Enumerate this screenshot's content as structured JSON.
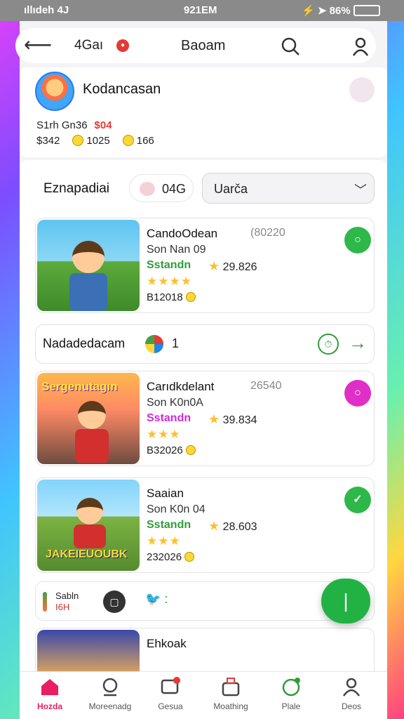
{
  "status_bar": {
    "left": "ıllıdeh 4J",
    "time": "921EM",
    "battery": "86%"
  },
  "header": {
    "back_icon": "back-arrow-icon",
    "tag": "4Gaı",
    "title": "Baoam"
  },
  "profile": {
    "name": "Kodancasan",
    "line1": "S1rh  Gn36",
    "line1_red": "$04",
    "cash": "$342",
    "coins1": "1025",
    "coins2": "166"
  },
  "filters": {
    "label": "Eznapadiai",
    "chip_value": "04G",
    "select_value": "Uarča"
  },
  "cards": [
    {
      "name": "CandoOdean",
      "num": "(80220",
      "sub": "Son Nan 09",
      "status": "Sstandn",
      "rating": "29.826",
      "stars": "★★★★",
      "price": "B12018",
      "badge_color": "#2eb84a"
    },
    {
      "name": "Carıdkdelant",
      "num": "26540",
      "sub": "Son K0n0A",
      "status": "Sstandn",
      "rating": "39.834",
      "stars": "★★★",
      "price": "B32026",
      "badge_color": "#e02fc6",
      "thumb_title": "Sergenutagın"
    },
    {
      "name": "Saaian",
      "num": "",
      "sub": "Son K0n 04",
      "status": "Sstandn",
      "rating": "28.603",
      "stars": "★★★",
      "price": "232026",
      "badge_color": "#2eb84a",
      "thumb_title": "JAKEIEUOUBK"
    }
  ],
  "banner": {
    "label": "Nadadedacam",
    "count": "1"
  },
  "mini": {
    "l1": "Sabln",
    "l2": "I6H"
  },
  "peek": {
    "name": "Ehkoak"
  },
  "nav": [
    "Hozda",
    "Moreenadg",
    "Gesua",
    "Moathing",
    "Plale",
    "Deos"
  ],
  "colors": {
    "accent_green": "#22b244",
    "accent_pink": "#e91e63"
  }
}
